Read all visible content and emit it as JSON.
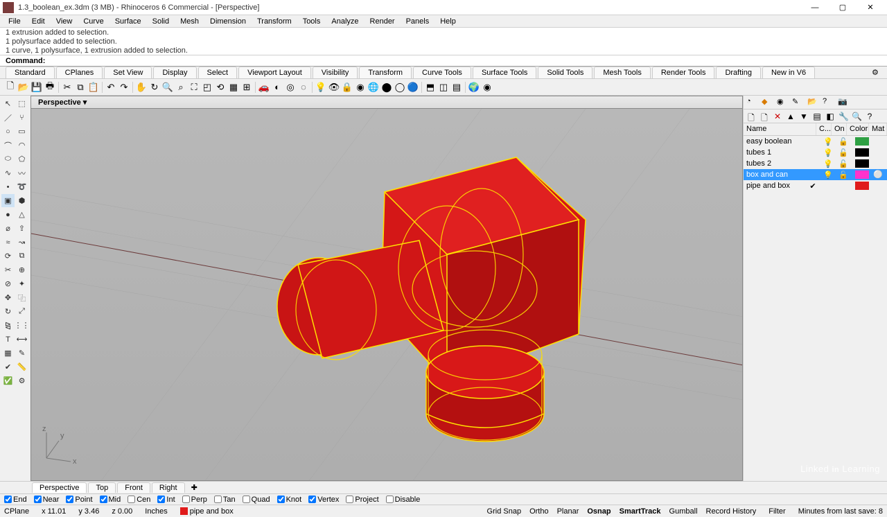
{
  "title": "1.3_boolean_ex.3dm (3 MB) - Rhinoceros 6 Commercial - [Perspective]",
  "menus": [
    "File",
    "Edit",
    "View",
    "Curve",
    "Surface",
    "Solid",
    "Mesh",
    "Dimension",
    "Transform",
    "Tools",
    "Analyze",
    "Render",
    "Panels",
    "Help"
  ],
  "history": [
    "1 extrusion added to selection.",
    "1 polysurface added to selection.",
    "1 curve, 1 polysurface, 1 extrusion added to selection."
  ],
  "command_label": "Command:",
  "command_value": "",
  "tabs": [
    "Standard",
    "CPlanes",
    "Set View",
    "Display",
    "Select",
    "Viewport Layout",
    "Visibility",
    "Transform",
    "Curve Tools",
    "Surface Tools",
    "Solid Tools",
    "Mesh Tools",
    "Render Tools",
    "Drafting",
    "New in V6"
  ],
  "viewport_tab": "Perspective",
  "axis_labels": {
    "x": "x",
    "y": "y",
    "z": "z"
  },
  "layers_headers": {
    "name": "Name",
    "cur": "C...",
    "on": "On",
    "color": "Color",
    "mat": "Mat"
  },
  "layers": [
    {
      "name": "easy boolean",
      "on": "💡",
      "lock": "🔓",
      "color": "#2ea043",
      "mat": "",
      "sel": false,
      "check": false
    },
    {
      "name": "tubes 1",
      "on": "💡",
      "lock": "🔓",
      "color": "#000000",
      "mat": "",
      "sel": false,
      "check": false
    },
    {
      "name": "tubes 2",
      "on": "💡",
      "lock": "🔓",
      "color": "#000000",
      "mat": "",
      "sel": false,
      "check": false
    },
    {
      "name": "box and can",
      "on": "💡",
      "lock": "🔓",
      "color": "#ff33cc",
      "mat": "⚪",
      "sel": true,
      "check": false
    },
    {
      "name": "pipe and box",
      "on": "",
      "lock": "",
      "color": "#e01b1b",
      "mat": "",
      "sel": false,
      "check": true
    }
  ],
  "viewtabs": [
    "Perspective",
    "Top",
    "Front",
    "Right"
  ],
  "osnap": [
    {
      "label": "End",
      "checked": true
    },
    {
      "label": "Near",
      "checked": true
    },
    {
      "label": "Point",
      "checked": true
    },
    {
      "label": "Mid",
      "checked": true
    },
    {
      "label": "Cen",
      "checked": false
    },
    {
      "label": "Int",
      "checked": true
    },
    {
      "label": "Perp",
      "checked": false
    },
    {
      "label": "Tan",
      "checked": false
    },
    {
      "label": "Quad",
      "checked": false
    },
    {
      "label": "Knot",
      "checked": true
    },
    {
      "label": "Vertex",
      "checked": true
    },
    {
      "label": "Project",
      "checked": false
    },
    {
      "label": "Disable",
      "checked": false
    }
  ],
  "status": {
    "cplane": "CPlane",
    "x": "x 11.01",
    "y": "y 3.46",
    "z": "z 0.00",
    "units": "Inches",
    "layer_color": "#e01b1b",
    "layer_name": "pipe and box",
    "toggles": [
      {
        "t": "Grid Snap",
        "b": false
      },
      {
        "t": "Ortho",
        "b": false
      },
      {
        "t": "Planar",
        "b": false
      },
      {
        "t": "Osnap",
        "b": true
      },
      {
        "t": "SmartTrack",
        "b": true
      },
      {
        "t": "Gumball",
        "b": false
      },
      {
        "t": "Record History",
        "b": false
      }
    ],
    "filter": "Filter",
    "save": "Minutes from last save: 8"
  },
  "winbtns": {
    "min": "—",
    "max": "▢",
    "close": "✕"
  }
}
